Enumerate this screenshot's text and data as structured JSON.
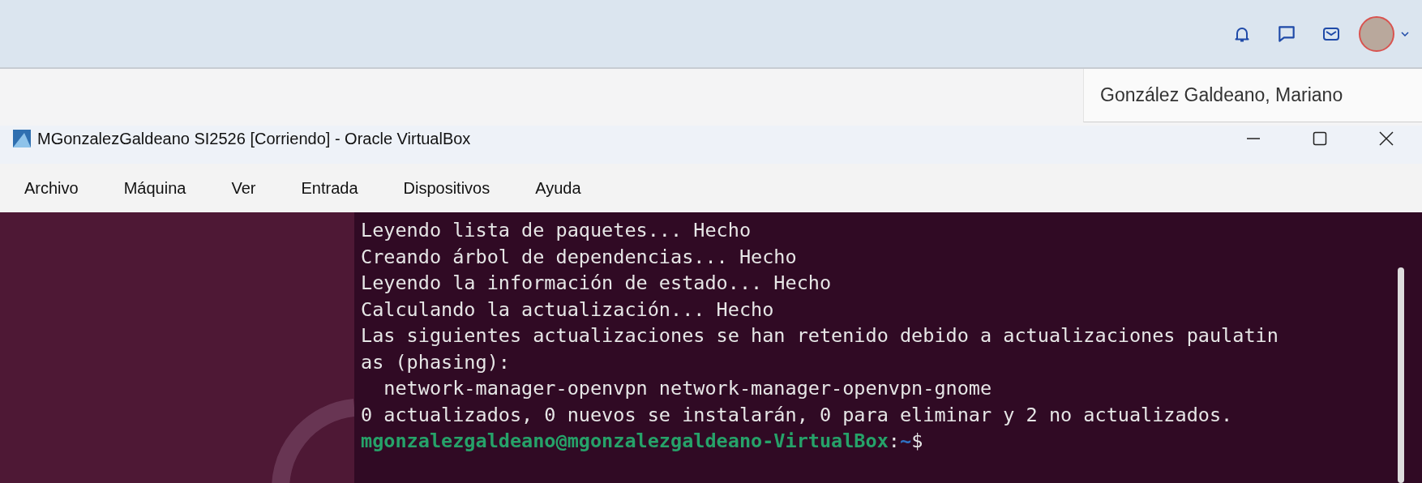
{
  "header": {
    "user_name": "González Galdeano, Mariano"
  },
  "window": {
    "title": "MGonzalezGaldeano SI2526 [Corriendo] - Oracle VirtualBox"
  },
  "menu": [
    "Archivo",
    "Máquina",
    "Ver",
    "Entrada",
    "Dispositivos",
    "Ayuda"
  ],
  "terminal": {
    "lines": [
      "Leyendo lista de paquetes... Hecho",
      "Creando árbol de dependencias... Hecho",
      "Leyendo la información de estado... Hecho",
      "Calculando la actualización... Hecho",
      "Las siguientes actualizaciones se han retenido debido a actualizaciones paulatin",
      "as (phasing):",
      "  network-manager-openvpn network-manager-openvpn-gnome",
      "0 actualizados, 0 nuevos se instalarán, 0 para eliminar y 2 no actualizados."
    ],
    "prompt": {
      "user_host": "mgonzalezgaldeano@mgonzalezgaldeano-VirtualBox",
      "separator": ":",
      "path": "~",
      "symbol": "$"
    }
  }
}
